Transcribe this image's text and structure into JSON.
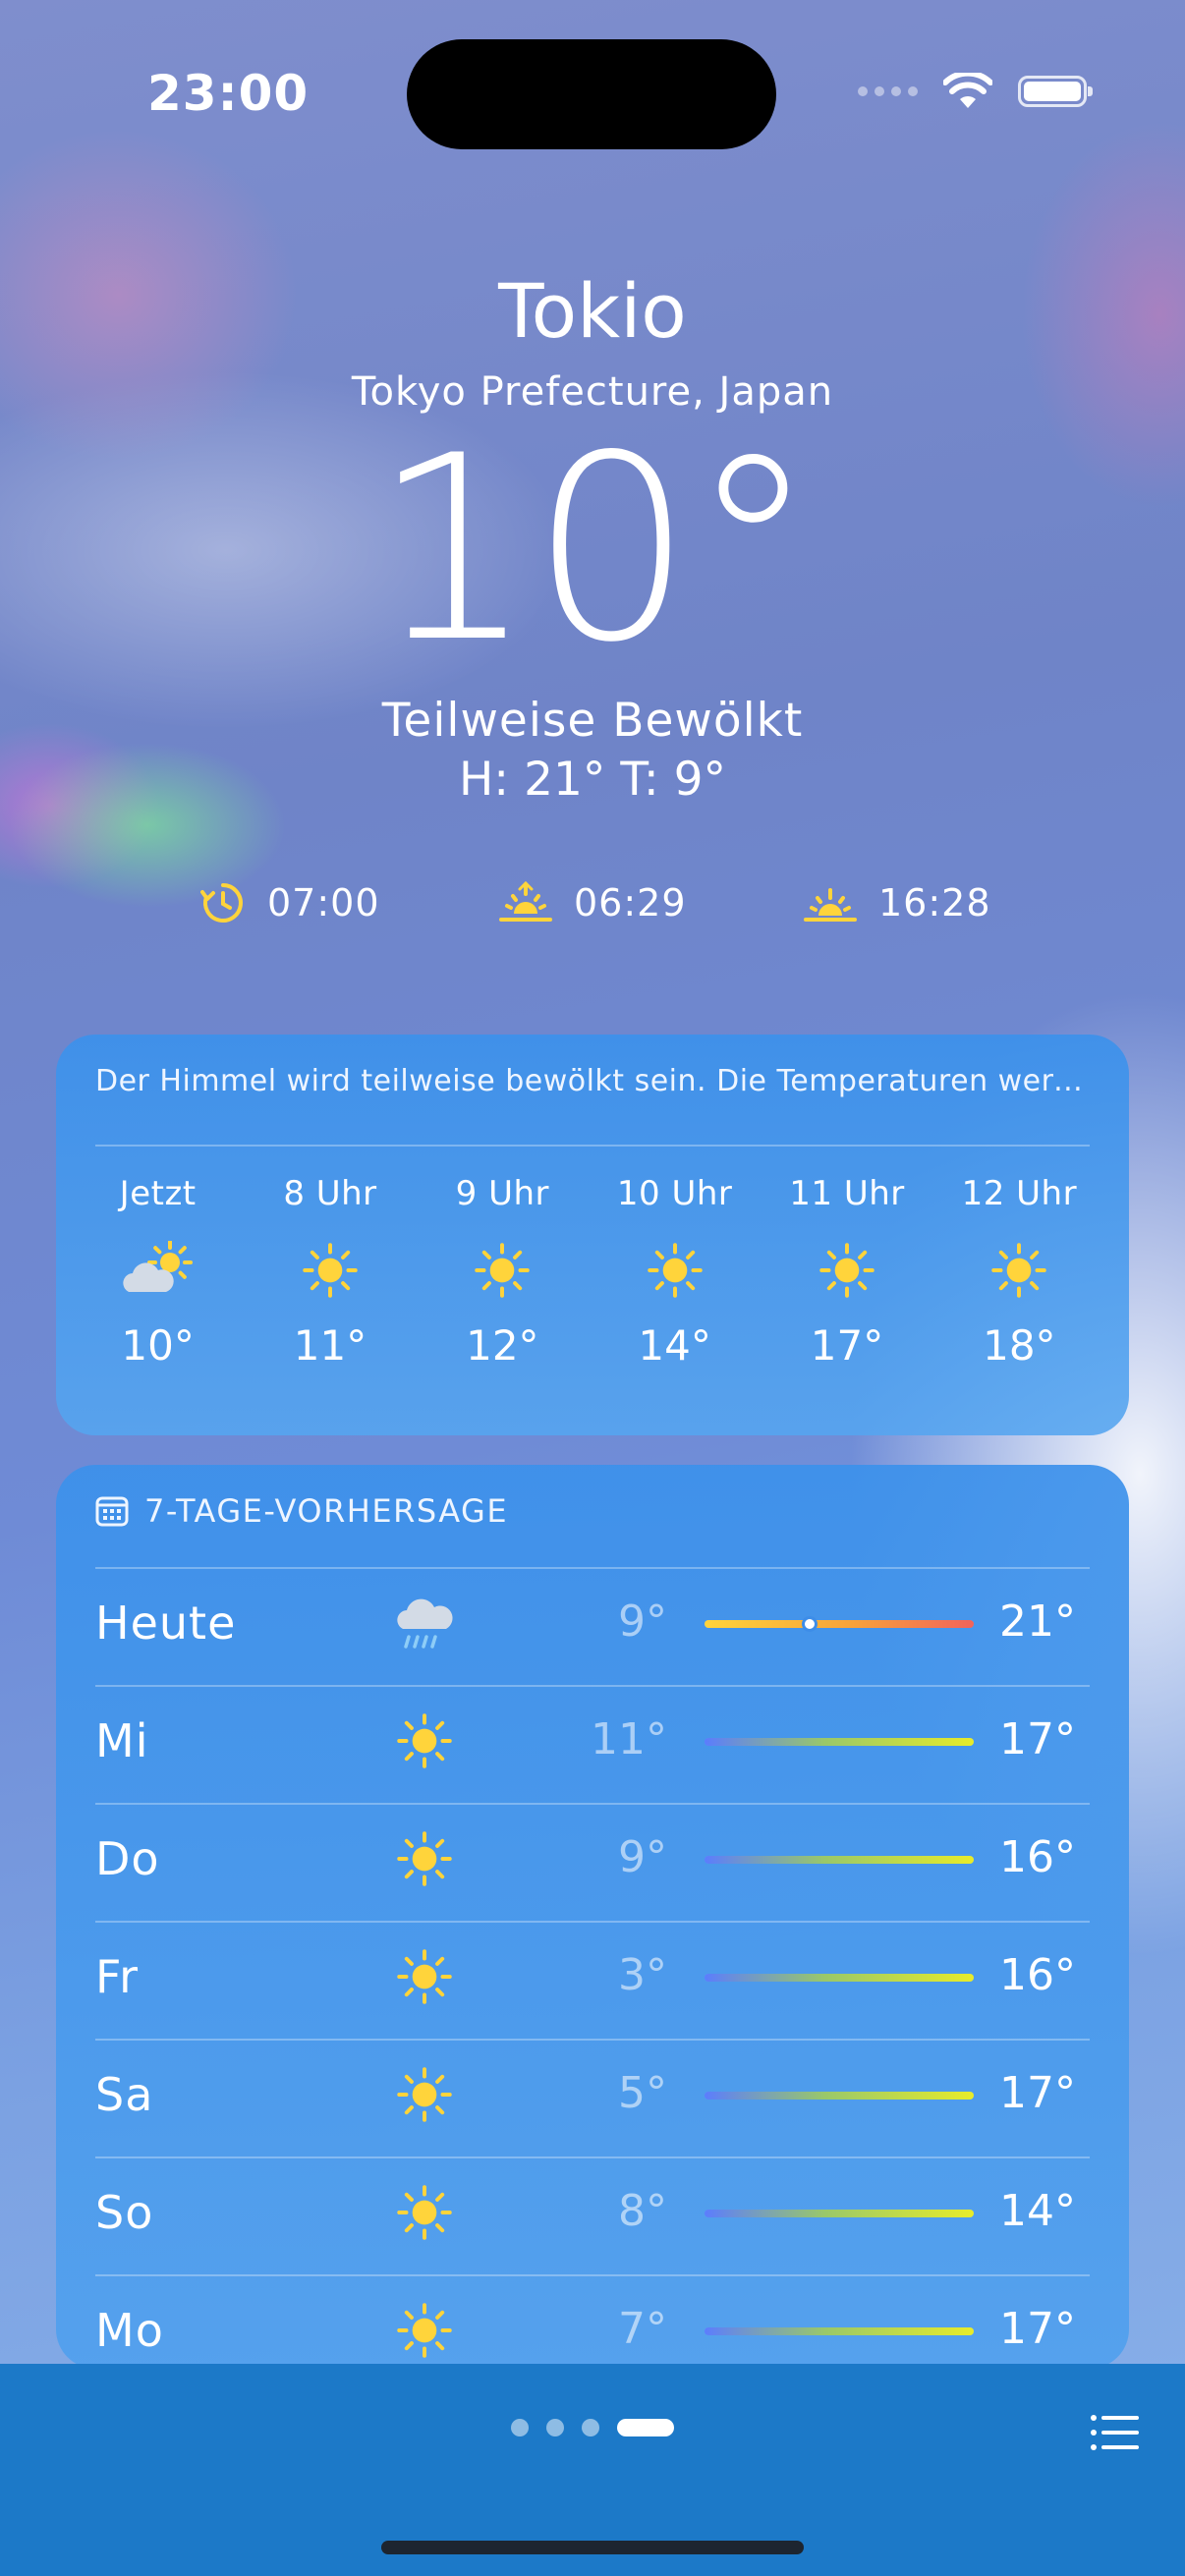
{
  "status_bar": {
    "time": "23:00"
  },
  "location": {
    "city": "Tokio",
    "region": "Tokyo Prefecture, Japan",
    "temperature": "10°",
    "condition": "Teilweise Bewölkt",
    "high_low": "H: 21° T: 9°"
  },
  "sun_info": {
    "clock": {
      "icon": "clock-arrow-icon",
      "time": "07:00"
    },
    "sunrise": {
      "icon": "sunrise-icon",
      "time": "06:29"
    },
    "sunset": {
      "icon": "sunset-icon",
      "time": "16:28"
    }
  },
  "hourly": {
    "summary": "Der Himmel wird teilweise bewölkt sein. Die Temperaturen werd...",
    "items": [
      {
        "label": "Jetzt",
        "icon": "partly-cloudy-icon",
        "temp": "10°"
      },
      {
        "label": "8 Uhr",
        "icon": "sun-icon",
        "temp": "11°"
      },
      {
        "label": "9 Uhr",
        "icon": "sun-icon",
        "temp": "12°"
      },
      {
        "label": "10 Uhr",
        "icon": "sun-icon",
        "temp": "14°"
      },
      {
        "label": "11 Uhr",
        "icon": "sun-icon",
        "temp": "17°"
      },
      {
        "label": "12 Uhr",
        "icon": "sun-icon",
        "temp": "18°"
      }
    ]
  },
  "daily": {
    "header": "7-TAGE-VORHERSAGE",
    "header_icon": "calendar-icon",
    "range_min": 3,
    "range_max": 21,
    "days": [
      {
        "day": "Heute",
        "icon": "rain-icon",
        "low": "9°",
        "high": "21°",
        "low_val": 9,
        "high_val": 21,
        "current_val": 10
      },
      {
        "day": "Mi",
        "icon": "sun-icon",
        "low": "11°",
        "high": "17°",
        "low_val": 11,
        "high_val": 17
      },
      {
        "day": "Do",
        "icon": "sun-icon",
        "low": "9°",
        "high": "16°",
        "low_val": 9,
        "high_val": 16
      },
      {
        "day": "Fr",
        "icon": "sun-icon",
        "low": "3°",
        "high": "16°",
        "low_val": 3,
        "high_val": 16
      },
      {
        "day": "Sa",
        "icon": "sun-icon",
        "low": "5°",
        "high": "17°",
        "low_val": 5,
        "high_val": 17
      },
      {
        "day": "So",
        "icon": "sun-icon",
        "low": "8°",
        "high": "14°",
        "low_val": 8,
        "high_val": 14
      },
      {
        "day": "Mo",
        "icon": "sun-icon",
        "low": "7°",
        "high": "17°",
        "low_val": 7,
        "high_val": 17
      }
    ]
  },
  "bottom_bar": {
    "pages": 4,
    "active_page": 3,
    "list_icon": "list-icon"
  },
  "colors": {
    "sun_yellow": "#ffd43b",
    "card_blue": "#3f92ea",
    "bottom_bar": "#1c79c8"
  }
}
